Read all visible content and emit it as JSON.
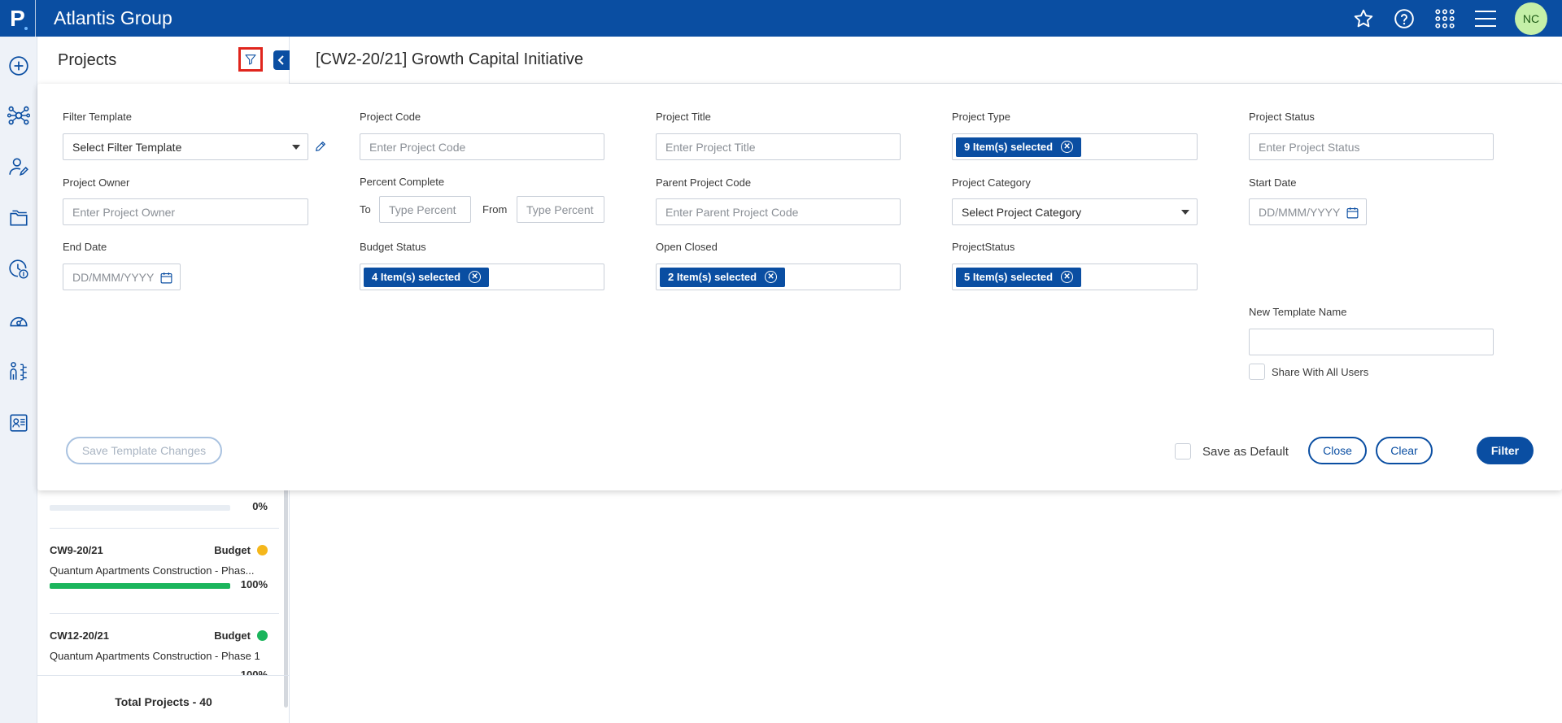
{
  "app": {
    "logo_letter": "P",
    "org_name": "Atlantis Group",
    "user_initials": "NC"
  },
  "top_icons": [
    "star-icon",
    "help-icon",
    "apps-grid-icon",
    "menu-icon"
  ],
  "rail_icons": [
    "add-circle-icon",
    "network-icon",
    "user-edit-icon",
    "folders-icon",
    "clock-dollar-icon",
    "gauge-icon",
    "org-chart-icon",
    "report-icon"
  ],
  "projects_panel": {
    "title": "Projects",
    "items": [
      {
        "code": "",
        "title": "",
        "percent_label": "0%",
        "percent": 0
      },
      {
        "code": "CW9-20/21",
        "budget_label": "Budget",
        "budget_color": "#f5b71b",
        "title": "Quantum Apartments Construction - Phas...",
        "percent_label": "100%",
        "percent": 100
      },
      {
        "code": "CW12-20/21",
        "budget_label": "Budget",
        "budget_color": "#1bb55c",
        "title": "Quantum Apartments Construction - Phase 1",
        "percent_label": "100%",
        "percent": 100
      }
    ],
    "total_label": "Total Projects - 40"
  },
  "main": {
    "title": "[CW2-20/21] Growth Capital Initiative"
  },
  "filter": {
    "filter_template": {
      "label": "Filter Template",
      "value": "Select Filter Template"
    },
    "project_code": {
      "label": "Project Code",
      "placeholder": "Enter Project Code"
    },
    "project_title": {
      "label": "Project Title",
      "placeholder": "Enter Project Title"
    },
    "project_type": {
      "label": "Project Type",
      "chip": "9 Item(s) selected"
    },
    "project_status": {
      "label": "Project Status",
      "placeholder": "Enter Project Status"
    },
    "project_owner": {
      "label": "Project Owner",
      "placeholder": "Enter Project Owner"
    },
    "percent_complete": {
      "label": "Percent Complete",
      "to_label": "To",
      "from_label": "From",
      "to_placeholder": "Type Percent",
      "from_placeholder": "Type Percent"
    },
    "parent_project_code": {
      "label": "Parent Project Code",
      "placeholder": "Enter Parent Project Code"
    },
    "project_category": {
      "label": "Project Category",
      "value": "Select Project Category"
    },
    "start_date": {
      "label": "Start Date",
      "placeholder": "DD/MMM/YYYY"
    },
    "end_date": {
      "label": "End Date",
      "placeholder": "DD/MMM/YYYY"
    },
    "budget_status": {
      "label": "Budget Status",
      "chip": "4 Item(s) selected"
    },
    "open_closed": {
      "label": "Open Closed",
      "chip": "2 Item(s) selected"
    },
    "project_status2": {
      "label": "ProjectStatus",
      "chip": "5 Item(s) selected"
    },
    "new_template_name": {
      "label": "New Template Name",
      "value": ""
    },
    "share_with_all": {
      "label": "Share With All Users"
    },
    "save_template_changes": "Save Template Changes",
    "save_as_default": "Save as Default",
    "close": "Close",
    "clear": "Clear",
    "filter_button": "Filter"
  }
}
